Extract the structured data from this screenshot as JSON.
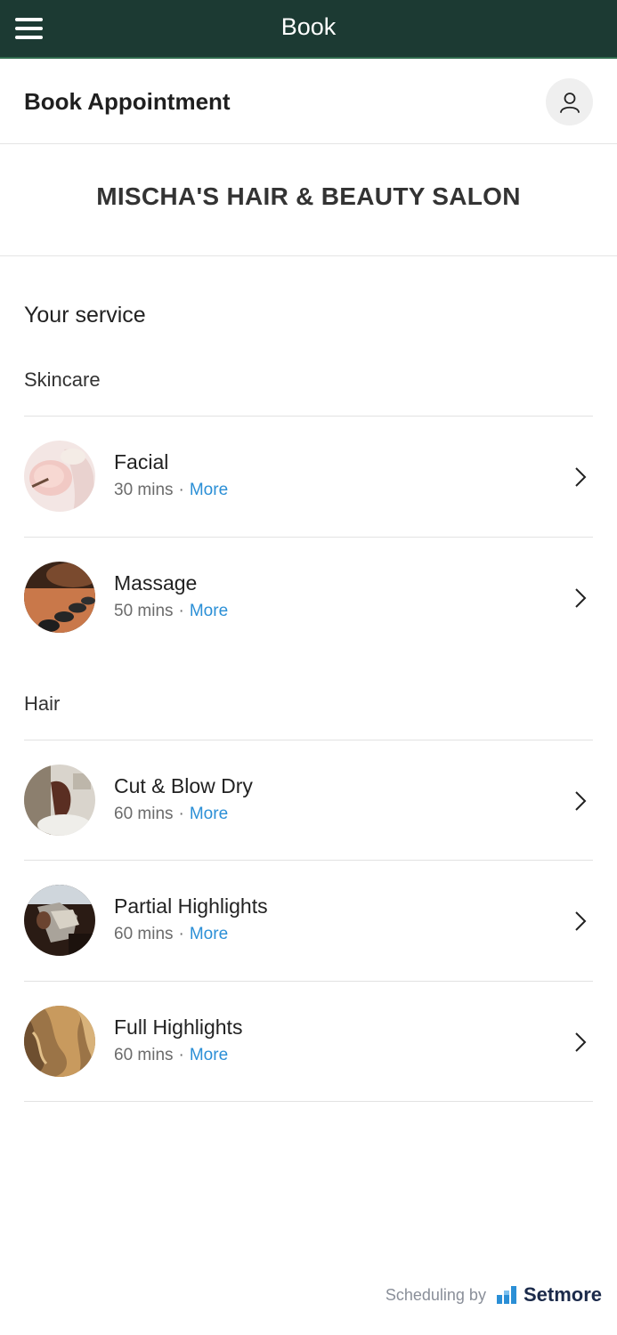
{
  "topbar": {
    "title": "Book"
  },
  "header": {
    "title": "Book Appointment"
  },
  "salon": {
    "name": "MISCHA'S HAIR & BEAUTY SALON"
  },
  "section": {
    "heading": "Your service"
  },
  "categories": [
    {
      "name": "Skincare"
    },
    {
      "name": "Hair"
    }
  ],
  "services": [
    {
      "name": "Facial",
      "duration": "30 mins",
      "more": "More",
      "icon": "facial-photo"
    },
    {
      "name": "Massage",
      "duration": "50 mins",
      "more": "More",
      "icon": "massage-stones-photo"
    },
    {
      "name": "Cut & Blow Dry",
      "duration": "60 mins",
      "more": "More",
      "icon": "hair-wash-photo"
    },
    {
      "name": "Partial Highlights",
      "duration": "60 mins",
      "more": "More",
      "icon": "foil-highlights-photo"
    },
    {
      "name": "Full Highlights",
      "duration": "60 mins",
      "more": "More",
      "icon": "wavy-highlights-photo"
    }
  ],
  "footer": {
    "text": "Scheduling by",
    "brand": "Setmore"
  },
  "colors": {
    "topbar": "#1c3a33",
    "link": "#2b8fd6",
    "brand": "#1b2a4a"
  }
}
